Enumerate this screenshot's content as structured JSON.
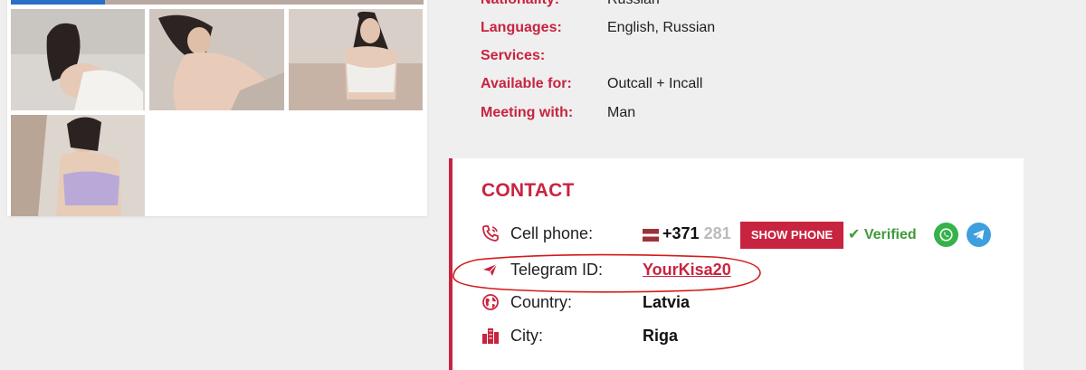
{
  "details": {
    "rows": [
      {
        "label": "Nationality:",
        "value": "Russian"
      },
      {
        "label": "Languages:",
        "value": "English, Russian"
      },
      {
        "label": "Services:",
        "value": ""
      },
      {
        "label": "Available for:",
        "value": "Outcall + Incall"
      },
      {
        "label": "Meeting with:",
        "value": "Man"
      }
    ]
  },
  "contact": {
    "title": "CONTACT",
    "cell_phone_label": "Cell phone:",
    "phone_prefix": "+371",
    "phone_partial": "281",
    "show_phone_label": "SHOW PHONE",
    "verified_label": "Verified",
    "telegram_label": "Telegram ID:",
    "telegram_value": "YourKisa20",
    "country_label": "Country:",
    "country_value": "Latvia",
    "city_label": "City:",
    "city_value": "Riga"
  },
  "icons": {
    "phone": "phone-icon",
    "telegram": "telegram-icon",
    "globe": "globe-icon",
    "city": "city-icon",
    "verified": "checkmark-icon",
    "whatsapp": "whatsapp-icon"
  },
  "colors": {
    "accent": "#c8243f",
    "verified": "#3d9a3a",
    "whatsapp": "#36b24a",
    "telegram": "#3e9fdf"
  }
}
